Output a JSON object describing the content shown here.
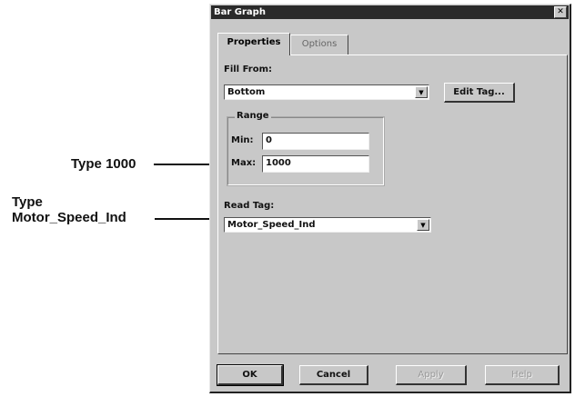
{
  "annotations": {
    "type_range": "Type 1000",
    "type_tag_line1": "Type",
    "type_tag_line2": "Motor_Speed_Ind"
  },
  "window": {
    "title": "Bar Graph",
    "close_glyph": "✕"
  },
  "tabs": [
    {
      "label": "Properties",
      "active": true
    },
    {
      "label": "Options",
      "active": false
    }
  ],
  "fill_from": {
    "label": "Fill From:",
    "value": "Bottom",
    "dropdown_glyph": "▼"
  },
  "edit_tag_button": "Edit Tag...",
  "range": {
    "label": "Range",
    "min_label": "Min:",
    "min_value": "0",
    "max_label": "Max:",
    "max_value": "1000"
  },
  "read_tag": {
    "label": "Read Tag:",
    "value": "Motor_Speed_Ind",
    "dropdown_glyph": "▼"
  },
  "buttons": {
    "ok": "OK",
    "cancel": "Cancel",
    "apply": "Apply",
    "help": "Help"
  }
}
